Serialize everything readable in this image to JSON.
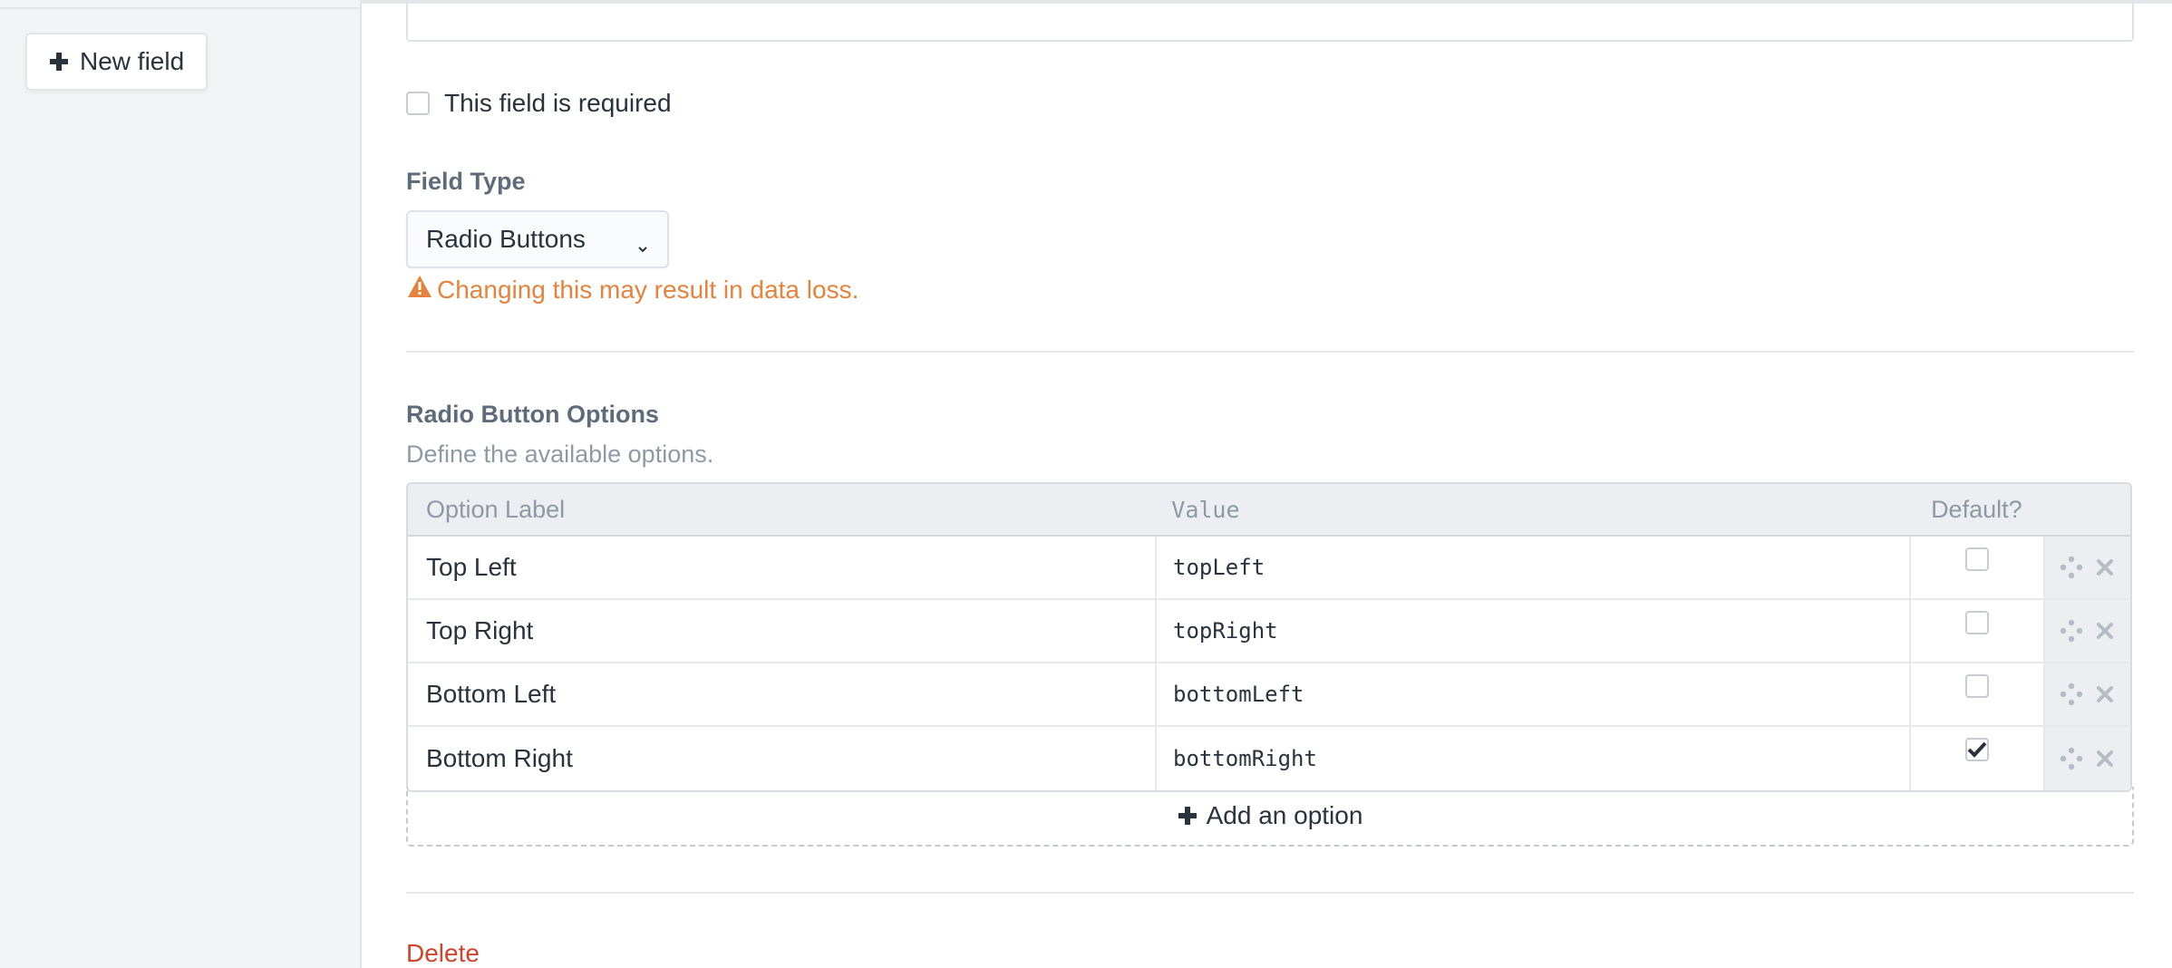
{
  "sidebar": {
    "new_field_label": "New field"
  },
  "field": {
    "required_label": "This field is required",
    "field_type_label": "Field Type",
    "field_type_value": "Radio Buttons",
    "warning_text": "Changing this may result in data loss."
  },
  "options": {
    "title": "Radio Button Options",
    "description": "Define the available options.",
    "columns": {
      "label": "Option Label",
      "value": "Value",
      "default": "Default?"
    },
    "rows": [
      {
        "label": "Top Left",
        "value": "topLeft",
        "default": false
      },
      {
        "label": "Top Right",
        "value": "topRight",
        "default": false
      },
      {
        "label": "Bottom Left",
        "value": "bottomLeft",
        "default": false
      },
      {
        "label": "Bottom Right",
        "value": "bottomRight",
        "default": true
      }
    ],
    "add_label": "Add an option"
  },
  "footer": {
    "delete_label": "Delete"
  },
  "colors": {
    "warning": "#e4833e",
    "danger": "#d0442e",
    "muted": "#8f99a6"
  }
}
